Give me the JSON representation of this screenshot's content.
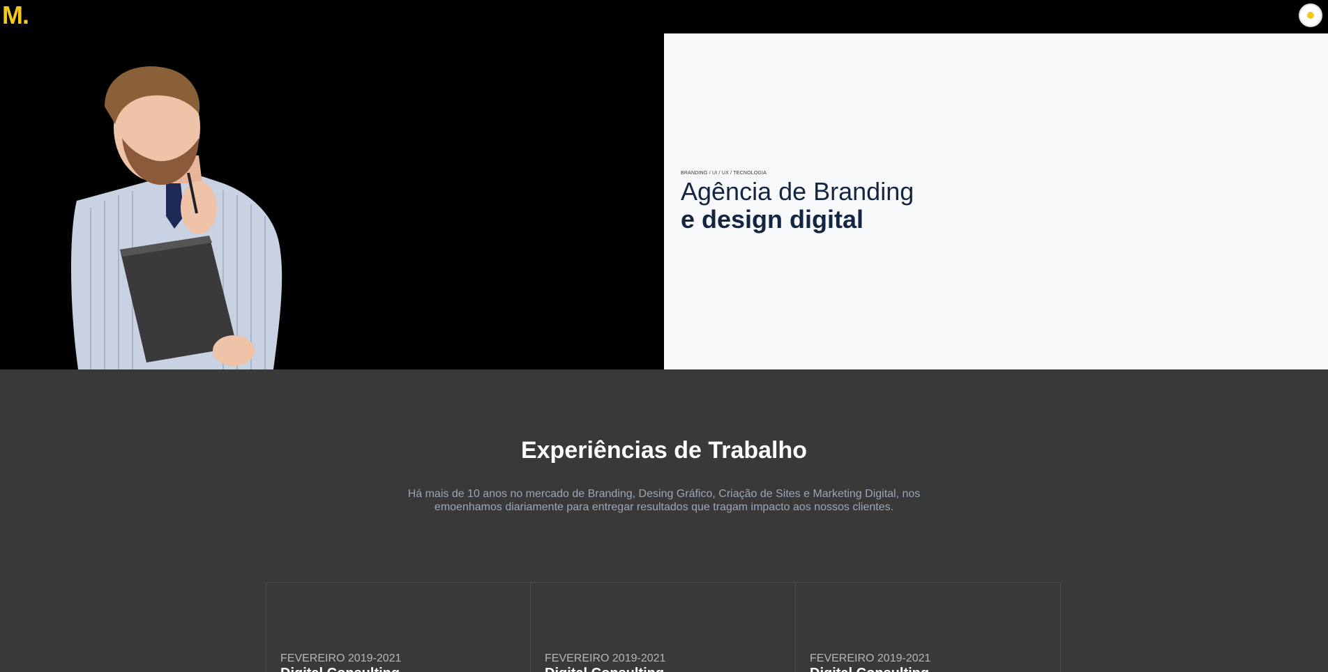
{
  "header": {
    "logo": "M.",
    "theme_toggle_icon": "sun-icon",
    "accent_color": "#f4c81b"
  },
  "hero": {
    "image_alt": "person-image",
    "tag": "BRANDING / UI / UX / TECNOLOGIA",
    "title_line1": "Agência de Branding",
    "title_line2": "e design digital",
    "title_color": "#142542"
  },
  "experiences": {
    "title": "Experiências de Trabalho",
    "description": "Há mais de 10 anos no mercado de Branding, Desing Gráfico, Criação de Sites e Marketing Digital, nos emoenhamos diariamente para entregar resultados que tragam impacto aos nossos clientes.",
    "cards": [
      {
        "date": "FEVEREIRO 2019-2021",
        "title": "Digital Consulting"
      },
      {
        "date": "FEVEREIRO 2019-2021",
        "title": "Digital Consulting"
      },
      {
        "date": "FEVEREIRO 2019-2021",
        "title": "Digital Consulting"
      }
    ]
  }
}
